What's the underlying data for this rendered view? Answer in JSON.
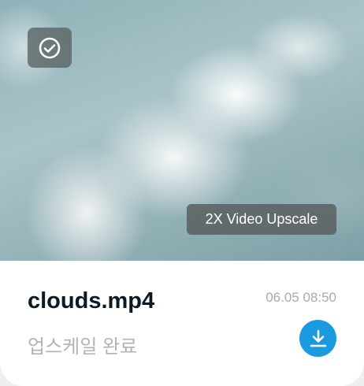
{
  "thumbnail": {
    "badge": "2X Video Upscale",
    "selected": true,
    "icon": "check-circle-icon"
  },
  "file": {
    "name": "clouds.mp4",
    "status": "업스케일 완료",
    "timestamp": "06.05 08:50"
  },
  "download": {
    "icon": "download-icon",
    "color": "#1a9be0"
  }
}
